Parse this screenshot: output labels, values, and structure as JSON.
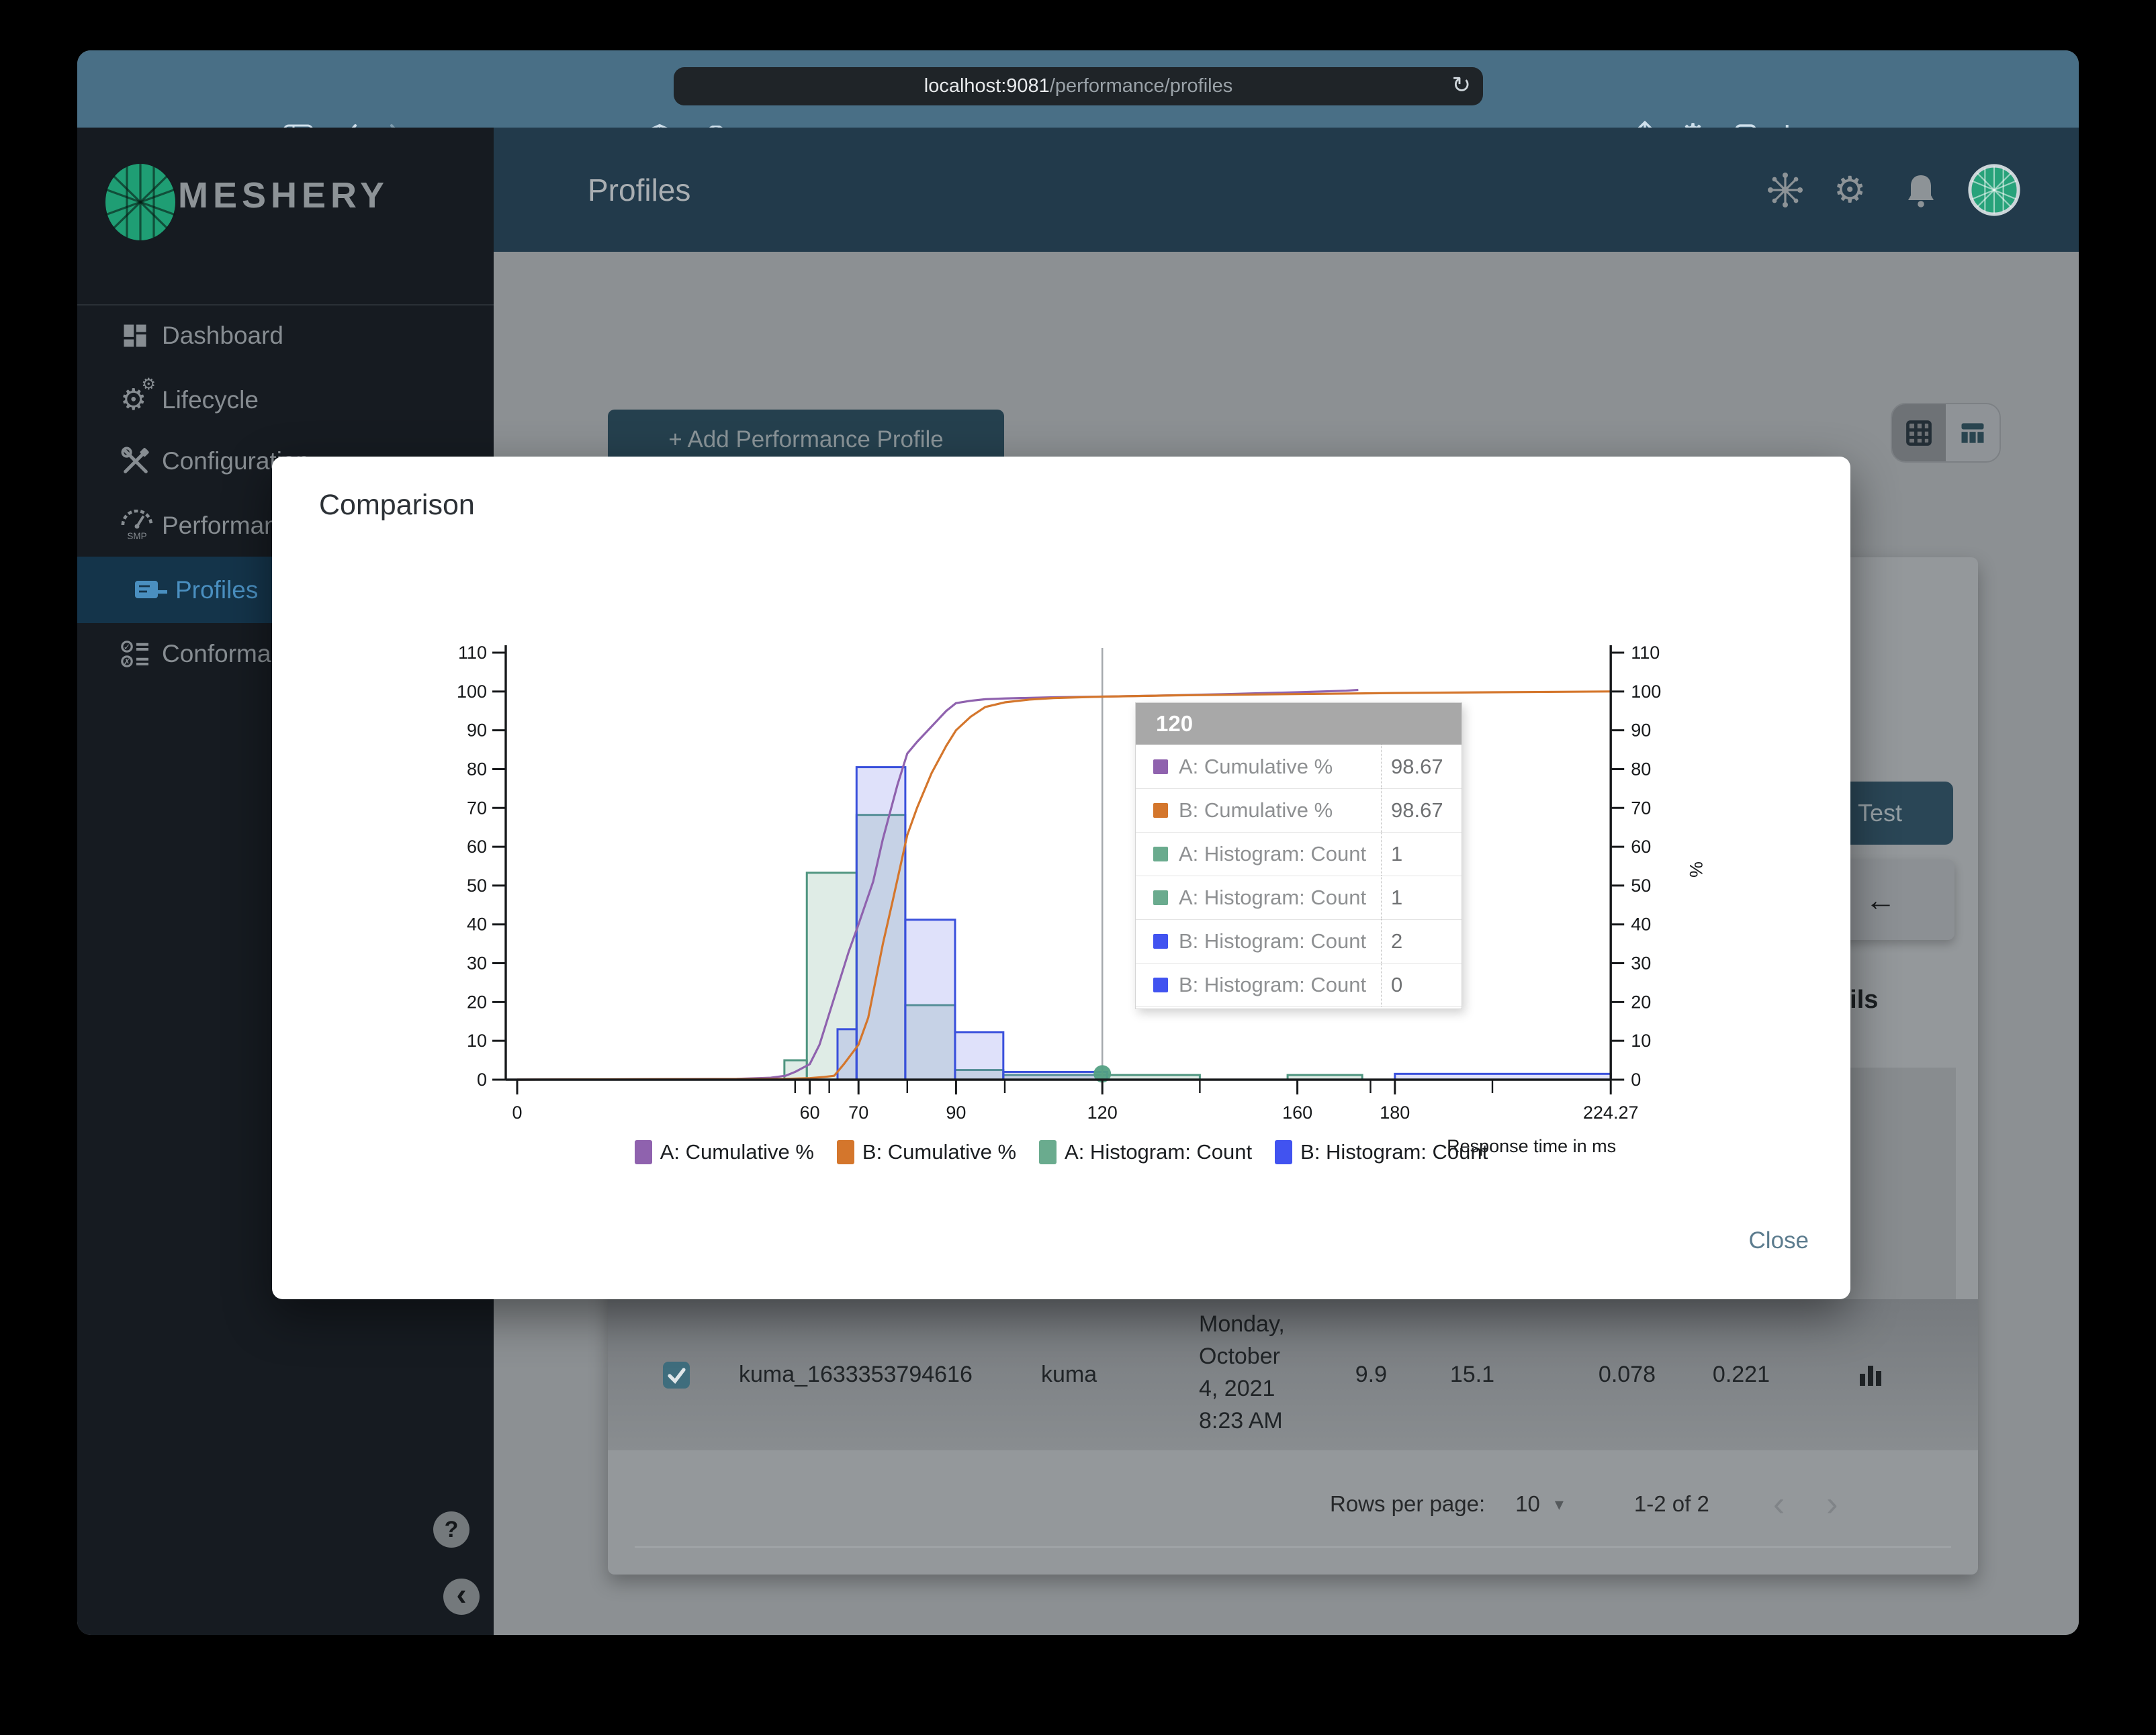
{
  "browser": {
    "url_host": "localhost:9081",
    "url_path": "/performance/profiles",
    "reload_glyph": "↻",
    "plus_glyph": "+"
  },
  "sidebar": {
    "brand": "MESHERY",
    "items": [
      {
        "label": "Dashboard"
      },
      {
        "label": "Lifecycle"
      },
      {
        "label": "Configuration"
      },
      {
        "label": "Performance"
      },
      {
        "label": "Profiles"
      },
      {
        "label": "Conformance"
      }
    ],
    "help_glyph": "?",
    "collapse_glyph": "‹"
  },
  "header": {
    "title": "Profiles"
  },
  "content": {
    "add_button": "+ Add Performance Profile",
    "test_button": "Test",
    "back_arrow": "←",
    "details_partial": "ails",
    "table_row": {
      "name": "kuma_1633353794616",
      "mesh": "kuma",
      "date_lines": [
        "Monday,",
        "October",
        "4, 2021",
        "8:23 AM"
      ],
      "qps": "9.9",
      "duration": "15.1",
      "p50": "0.078",
      "p99": "0.221"
    },
    "pagination": {
      "rows_per_page_label": "Rows per page:",
      "rows_per_page_value": "10",
      "caret": "▾",
      "range": "1-2 of 2",
      "prev": "‹",
      "next": "›"
    }
  },
  "modal": {
    "title": "Comparison",
    "close_label": "Close",
    "tooltip": {
      "title": "120",
      "rows": [
        {
          "swatch": "#8f62ae",
          "label": "A: Cumulative %",
          "value": "98.67"
        },
        {
          "swatch": "#d4762c",
          "label": "B: Cumulative %",
          "value": "98.67"
        },
        {
          "swatch": "#6aab8e",
          "label": "A: Histogram: Count",
          "value": "1"
        },
        {
          "swatch": "#6aab8e",
          "label": "A: Histogram: Count",
          "value": "1"
        },
        {
          "swatch": "#4153f0",
          "label": "B: Histogram: Count",
          "value": "2"
        },
        {
          "swatch": "#4153f0",
          "label": "B: Histogram: Count",
          "value": "0"
        }
      ]
    },
    "legend": [
      {
        "swatch": "#8f62ae",
        "label": "A: Cumulative %"
      },
      {
        "swatch": "#d4762c",
        "label": "B: Cumulative %"
      },
      {
        "swatch": "#6aab8e",
        "label": "A: Histogram: Count"
      },
      {
        "swatch": "#4153f0",
        "label": "B: Histogram: Count"
      }
    ]
  },
  "chart_data": {
    "type": "bar",
    "subtype": "histogram-with-cumulative-lines",
    "title": "Comparison",
    "xlabel": "Response time in ms",
    "ylabel": "",
    "right_ylabel": "%",
    "xlim": [
      -2.5,
      225.8
    ],
    "ylim": [
      0,
      110
    ],
    "y_ticks": [
      0,
      10,
      20,
      30,
      40,
      50,
      60,
      70,
      80,
      90,
      100,
      110
    ],
    "x_major_ticks": [
      {
        "v": 0,
        "label": "0"
      },
      {
        "v": 60,
        "label": "60"
      },
      {
        "v": 70,
        "label": "70"
      },
      {
        "v": 90,
        "label": "90"
      },
      {
        "v": 120,
        "label": "120"
      },
      {
        "v": 160,
        "label": "160"
      },
      {
        "v": 180,
        "label": "180"
      },
      {
        "v": 224.27,
        "label": "224.27"
      }
    ],
    "x_minor_ticks": [
      57,
      64,
      80,
      100,
      140,
      175,
      200
    ],
    "crosshair_x": 120,
    "marker": {
      "x": 120,
      "y": 1.5,
      "color": "#53a083"
    },
    "series": [
      {
        "name": "A: Histogram: Count",
        "type": "histogram",
        "stroke": "#4f9580",
        "fill": "rgba(111,169,140,0.22)",
        "bars": [
          [
            54.8,
            59.4,
            5
          ],
          [
            59.4,
            69.6,
            53.3
          ],
          [
            69.6,
            79.6,
            68.2
          ],
          [
            79.6,
            89.8,
            19.2
          ],
          [
            89.8,
            99.7,
            2.5
          ],
          [
            99.7,
            140,
            1.2
          ],
          [
            158,
            173.3,
            1.2
          ]
        ]
      },
      {
        "name": "B: Histogram: Count",
        "type": "histogram",
        "stroke": "#3a50dc",
        "fill": "rgba(110,120,230,0.22)",
        "bars": [
          [
            65.7,
            69.6,
            13
          ],
          [
            69.6,
            79.6,
            80.5
          ],
          [
            79.6,
            89.8,
            41.2
          ],
          [
            89.8,
            99.7,
            12.2
          ],
          [
            99.7,
            121,
            2
          ],
          [
            180,
            224.27,
            1.5
          ]
        ]
      },
      {
        "name": "A: Cumulative %",
        "type": "line",
        "color": "#8f62ae",
        "points": [
          [
            0,
            0
          ],
          [
            45,
            0.2
          ],
          [
            52,
            0.5
          ],
          [
            55,
            1
          ],
          [
            57,
            2
          ],
          [
            60,
            4
          ],
          [
            62,
            9
          ],
          [
            65,
            21
          ],
          [
            68,
            33
          ],
          [
            70,
            40
          ],
          [
            73,
            51
          ],
          [
            75,
            62
          ],
          [
            78,
            76
          ],
          [
            80,
            84
          ],
          [
            82,
            87
          ],
          [
            85,
            91
          ],
          [
            88,
            95
          ],
          [
            90,
            97
          ],
          [
            93,
            97.6
          ],
          [
            96,
            98
          ],
          [
            100,
            98.2
          ],
          [
            110,
            98.5
          ],
          [
            120,
            98.67
          ],
          [
            130,
            98.9
          ],
          [
            145,
            99.3
          ],
          [
            160,
            99.8
          ],
          [
            170,
            100.2
          ],
          [
            172.5,
            100.4
          ]
        ]
      },
      {
        "name": "B: Cumulative %",
        "type": "line",
        "color": "#d4762c",
        "points": [
          [
            0,
            0
          ],
          [
            55,
            0.2
          ],
          [
            60,
            0.4
          ],
          [
            63,
            0.7
          ],
          [
            65,
            1
          ],
          [
            67,
            4
          ],
          [
            70,
            9
          ],
          [
            72,
            16
          ],
          [
            75,
            35
          ],
          [
            77,
            46
          ],
          [
            80,
            63
          ],
          [
            82,
            70
          ],
          [
            85,
            79
          ],
          [
            88,
            86
          ],
          [
            90,
            90
          ],
          [
            93,
            93.5
          ],
          [
            96,
            96
          ],
          [
            100,
            97.2
          ],
          [
            105,
            97.9
          ],
          [
            110,
            98.3
          ],
          [
            120,
            98.67
          ],
          [
            135,
            99
          ],
          [
            150,
            99.2
          ],
          [
            165,
            99.4
          ],
          [
            180,
            99.6
          ],
          [
            200,
            99.8
          ],
          [
            224.27,
            100
          ]
        ]
      }
    ]
  }
}
